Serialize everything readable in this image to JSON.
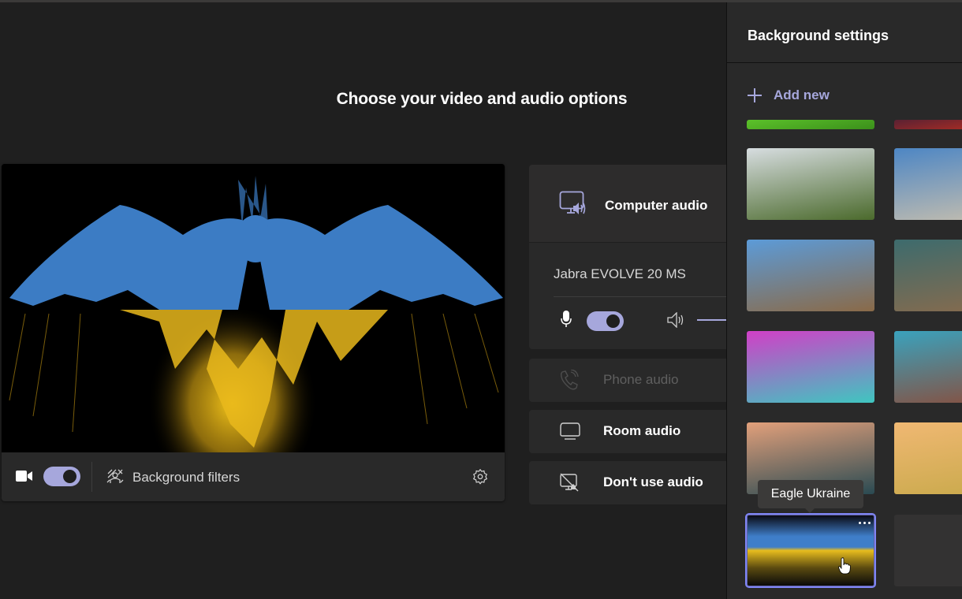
{
  "main": {
    "title": "Choose your video and audio options"
  },
  "video": {
    "camera_on": true,
    "background_filters_label": "Background filters",
    "preview_background": "Eagle Ukraine"
  },
  "audio": {
    "selected_option": "Computer audio",
    "device_name": "Jabra EVOLVE 20 MS",
    "mic_on": true,
    "options": [
      {
        "label": "Computer audio",
        "icon": "computer-speaker-icon",
        "enabled": true
      },
      {
        "label": "Phone audio",
        "icon": "phone-icon",
        "enabled": false
      },
      {
        "label": "Room audio",
        "icon": "room-device-icon",
        "enabled": true
      },
      {
        "label": "Don't use audio",
        "icon": "no-audio-icon",
        "enabled": true
      }
    ]
  },
  "background_settings": {
    "title": "Background settings",
    "add_new_label": "Add new",
    "tooltip": "Eagle Ukraine",
    "selected": "Eagle Ukraine",
    "thumbnails": [
      {
        "name": "green-pixel-scene",
        "colors": [
          "#5cc22a",
          "#3b8f1b"
        ]
      },
      {
        "name": "red-purple-scene",
        "colors": [
          "#5a2133",
          "#c2301f"
        ]
      },
      {
        "name": "mountain-valley",
        "colors": [
          "#d7dde0",
          "#4b6a2c"
        ]
      },
      {
        "name": "desert-ruins",
        "colors": [
          "#4d86c4",
          "#c9c0ae"
        ]
      },
      {
        "name": "medieval-village",
        "colors": [
          "#5c9bd8",
          "#8a6a48"
        ]
      },
      {
        "name": "sci-fi-landscape",
        "colors": [
          "#3d6b6d",
          "#8a6b4c"
        ]
      },
      {
        "name": "pink-nebula",
        "colors": [
          "#d13fc7",
          "#3fc6c0"
        ]
      },
      {
        "name": "canyon-tower",
        "colors": [
          "#3aa2bd",
          "#8a4c3a"
        ]
      },
      {
        "name": "sunset-street",
        "colors": [
          "#e2a07b",
          "#2a4a52"
        ]
      },
      {
        "name": "painted-meadow",
        "colors": [
          "#f0b873",
          "#c8a94a"
        ]
      },
      {
        "name": "Eagle Ukraine",
        "colors": [
          "#3f7ec9",
          "#e8bd1e"
        ]
      },
      {
        "name": "empty-slot",
        "colors": [
          "#333232",
          "#333232"
        ]
      }
    ],
    "more_options_icon": "ellipsis-icon"
  },
  "colors": {
    "accent": "#a6a7dc",
    "background": "#1f1f1f",
    "panel": "#292929"
  }
}
